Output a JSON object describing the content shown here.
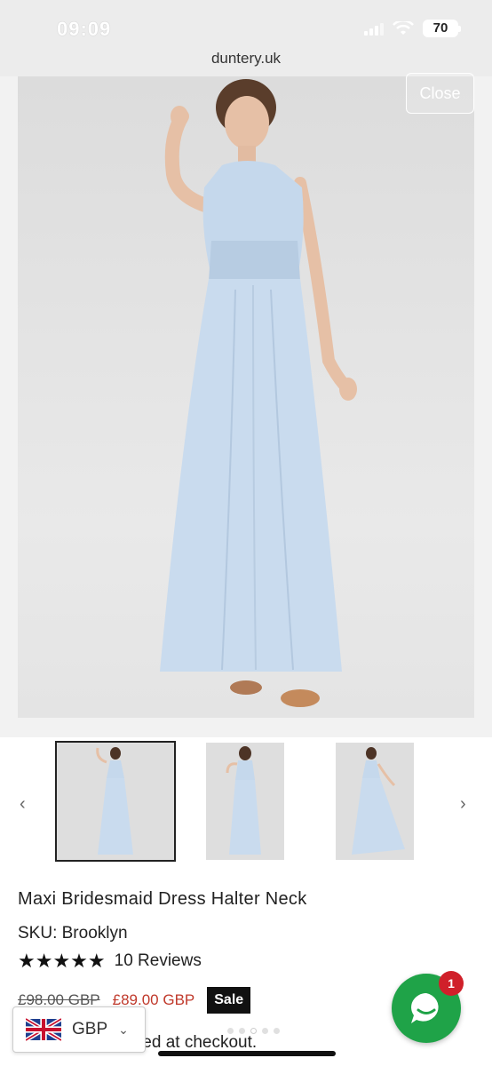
{
  "status": {
    "time": "09:09",
    "battery": "70"
  },
  "browser": {
    "url": "duntery.uk"
  },
  "gallery": {
    "close_label": "Close",
    "prev_label": "‹",
    "next_label": "›"
  },
  "product": {
    "title": "Maxi Bridesmaid Dress Halter Neck",
    "sku": "SKU: Brooklyn",
    "rating": 5,
    "stars": "★★★★★",
    "reviews": "10 Reviews",
    "old_price": "£98.00 GBP",
    "new_price": "£89.00 GBP",
    "sale_label": "Sale",
    "checkout_note": "ted at checkout."
  },
  "currency": {
    "code": "GBP",
    "chevron": "⌄"
  },
  "chat": {
    "badge_count": "1"
  },
  "colors": {
    "dress": "#c5d8ec",
    "chat": "#1fa348",
    "sale": "#111111",
    "price": "#c0392b",
    "badge": "#d0202a"
  },
  "carousel": {
    "count": 5,
    "active_index": 2
  }
}
